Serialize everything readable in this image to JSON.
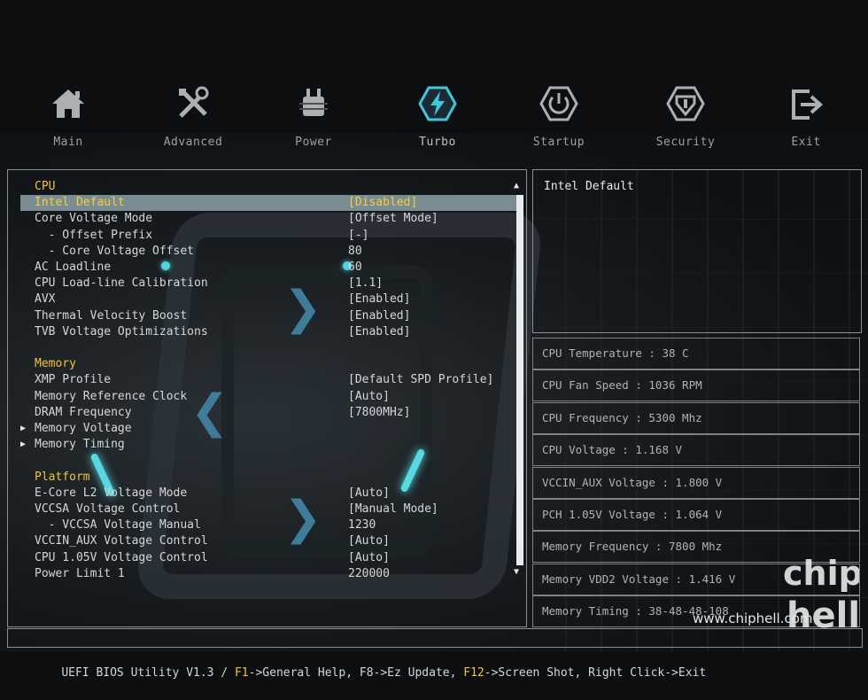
{
  "nav": [
    {
      "label": "Main",
      "icon": "home-icon"
    },
    {
      "label": "Advanced",
      "icon": "tools-icon"
    },
    {
      "label": "Power",
      "icon": "power-chip-icon"
    },
    {
      "label": "Turbo",
      "icon": "turbo-bolt-icon",
      "active": true
    },
    {
      "label": "Startup",
      "icon": "power-button-icon"
    },
    {
      "label": "Security",
      "icon": "shield-icon"
    },
    {
      "label": "Exit",
      "icon": "exit-icon"
    }
  ],
  "settings": [
    {
      "type": "section",
      "label": "CPU"
    },
    {
      "type": "item",
      "label": "Intel Default",
      "value": "[Disabled]",
      "selected": true
    },
    {
      "type": "item",
      "label": "Core Voltage Mode",
      "value": "[Offset Mode]"
    },
    {
      "type": "item",
      "label": "  - Offset Prefix",
      "value": "[-]"
    },
    {
      "type": "item",
      "label": "  - Core Voltage Offset",
      "value": "80"
    },
    {
      "type": "item",
      "label": "AC Loadline",
      "value": "60"
    },
    {
      "type": "item",
      "label": "CPU Load-line Calibration",
      "value": "[1.1]"
    },
    {
      "type": "item",
      "label": "AVX",
      "value": "[Enabled]"
    },
    {
      "type": "item",
      "label": "Thermal Velocity Boost",
      "value": "[Enabled]"
    },
    {
      "type": "item",
      "label": "TVB Voltage Optimizations",
      "value": "[Enabled]"
    },
    {
      "type": "blank"
    },
    {
      "type": "section",
      "label": "Memory"
    },
    {
      "type": "item",
      "label": "XMP Profile",
      "value": "[Default SPD Profile]"
    },
    {
      "type": "item",
      "label": "Memory Reference Clock",
      "value": "[Auto]"
    },
    {
      "type": "item",
      "label": "DRAM Frequency",
      "value": "[7800MHz]"
    },
    {
      "type": "submenu",
      "label": "Memory Voltage"
    },
    {
      "type": "submenu",
      "label": "Memory Timing"
    },
    {
      "type": "blank"
    },
    {
      "type": "section",
      "label": "Platform"
    },
    {
      "type": "item",
      "label": "E-Core L2 Voltage Mode",
      "value": "[Auto]"
    },
    {
      "type": "item",
      "label": "VCCSA Voltage Control",
      "value": "[Manual Mode]"
    },
    {
      "type": "item",
      "label": "  - VCCSA Voltage Manual",
      "value": "1230"
    },
    {
      "type": "item",
      "label": "VCCIN_AUX Voltage Control",
      "value": "[Auto]"
    },
    {
      "type": "item",
      "label": "CPU 1.05V Voltage Control",
      "value": "[Auto]"
    },
    {
      "type": "item",
      "label": "Power Limit 1",
      "value": "220000"
    }
  ],
  "help_text": "Intel Default",
  "hardware": [
    "CPU Temperature : 38 C",
    "CPU Fan Speed : 1036 RPM",
    "CPU Frequency : 5300 Mhz",
    "CPU Voltage : 1.168 V",
    "VCCIN_AUX Voltage : 1.800 V",
    "PCH 1.05V Voltage : 1.064 V",
    "Memory Frequency : 7800 Mhz",
    "Memory VDD2 Voltage : 1.416 V",
    "Memory Timing : 38-48-48-108"
  ],
  "footer": {
    "prefix": "UEFI BIOS Utility V1.3 / ",
    "k1": "F1",
    "t1": "->General Help, F8->Ez Update, ",
    "k2": "F12",
    "t2": "->Screen Shot, Right Click->Exit"
  },
  "watermark_url": "www.chiphell.com",
  "watermark_logo_text": "chip hell",
  "colors": {
    "accent": "#f2c23a",
    "selected_bg": "#7a8d93",
    "turbo": "#42c6dd"
  }
}
